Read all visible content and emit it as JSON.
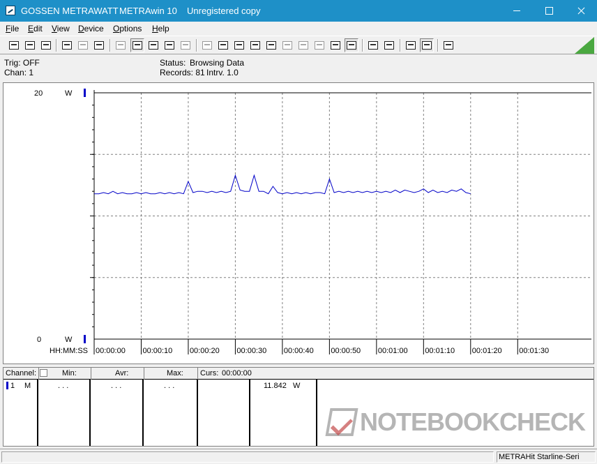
{
  "window": {
    "company": "GOSSEN METRAWATT",
    "app": "METRAwin 10",
    "license": "Unregistered copy",
    "title_bg": "#1e90c8"
  },
  "menu": [
    "File",
    "Edit",
    "View",
    "Device",
    "Options",
    "Help"
  ],
  "toolbar": {
    "icons": [
      "open-icon",
      "save-icon",
      "folder-icon",
      "device-read-icon",
      "device-icon",
      "device-write-icon",
      "keyboard-icon",
      "graph-mode-icon",
      "crosshair-icon",
      "table-icon",
      "bar-icon",
      "window-icon",
      "window-copy-icon",
      "list-icon",
      "computer-icon",
      "formula-icon",
      "wave-icon",
      "wave2-icon",
      "target-icon",
      "transmit-icon",
      "print-icon",
      "print-preview-icon",
      "zoom-wave-icon",
      "zoom-in-icon",
      "info-icon"
    ],
    "logo_color": "#4aa840"
  },
  "status": {
    "trig": "Trig: OFF",
    "chan": "Chan:  1",
    "status_label": "Status:",
    "status_value": "Browsing Data",
    "records": "Records: 81",
    "interval": "Intrv. 1.0"
  },
  "chart_data": {
    "type": "line",
    "ylim": [
      0,
      20
    ],
    "y_top_label": "20",
    "y_bottom_label": "0",
    "unit_top": "W",
    "unit_bottom": "W",
    "xlabel": "HH:MM:SS",
    "xlim": [
      0,
      95
    ],
    "x_ticks": [
      0,
      10,
      20,
      30,
      40,
      50,
      60,
      70,
      80,
      90
    ],
    "x_tick_labels": [
      "00:00:00",
      "00:00:10",
      "00:00:20",
      "00:00:30",
      "00:00:40",
      "00:00:50",
      "00:01:00",
      "00:01:10",
      "00:01:20",
      "00:01:30"
    ],
    "series": [
      {
        "color": "#0000c8",
        "x": [
          0,
          1,
          2,
          3,
          4,
          5,
          6,
          7,
          8,
          9,
          10,
          11,
          12,
          13,
          14,
          15,
          16,
          17,
          18,
          19,
          20,
          21,
          22,
          23,
          24,
          25,
          26,
          27,
          28,
          29,
          30,
          31,
          32,
          33,
          34,
          35,
          36,
          37,
          38,
          39,
          40,
          41,
          42,
          43,
          44,
          45,
          46,
          47,
          48,
          49,
          50,
          51,
          52,
          53,
          54,
          55,
          56,
          57,
          58,
          59,
          60,
          61,
          62,
          63,
          64,
          65,
          66,
          67,
          68,
          69,
          70,
          71,
          72,
          73,
          74,
          75,
          76,
          77,
          78,
          79,
          80
        ],
        "values": [
          11.8,
          11.8,
          11.9,
          11.8,
          12.0,
          11.8,
          11.9,
          11.8,
          11.8,
          11.9,
          11.8,
          11.9,
          11.8,
          11.8,
          11.9,
          11.8,
          11.9,
          11.8,
          11.9,
          11.8,
          12.8,
          11.9,
          12.0,
          12.0,
          11.9,
          12.0,
          11.9,
          12.0,
          11.9,
          12.0,
          13.3,
          12.1,
          12.0,
          12.0,
          13.3,
          12.0,
          12.0,
          11.8,
          12.4,
          11.9,
          11.8,
          11.9,
          11.8,
          11.9,
          11.8,
          11.9,
          11.8,
          11.9,
          11.9,
          11.8,
          13.0,
          11.9,
          12.0,
          11.9,
          12.0,
          11.9,
          12.0,
          11.9,
          12.0,
          11.9,
          12.0,
          11.9,
          12.0,
          11.9,
          12.1,
          11.9,
          12.1,
          12.0,
          11.9,
          12.0,
          12.2,
          11.9,
          12.1,
          11.9,
          12.0,
          11.9,
          12.1,
          12.0,
          12.2,
          11.9,
          11.8
        ]
      }
    ],
    "grid": true,
    "legend": "none"
  },
  "table": {
    "headers": {
      "channel": "Channel:",
      "min": "Min:",
      "avr": "Avr:",
      "max": "Max:",
      "curs": "Curs:",
      "curs_time": "00:00:00"
    },
    "row": {
      "num": "1",
      "mode": "M",
      "min": ". . .",
      "avr": ". . .",
      "max": ". . .",
      "curs_value": "11.842",
      "curs_unit": "W"
    }
  },
  "watermark": {
    "text": "NOTEBOOKCHECK"
  },
  "statusbar": {
    "device": "METRAHit Starline-Seri"
  }
}
